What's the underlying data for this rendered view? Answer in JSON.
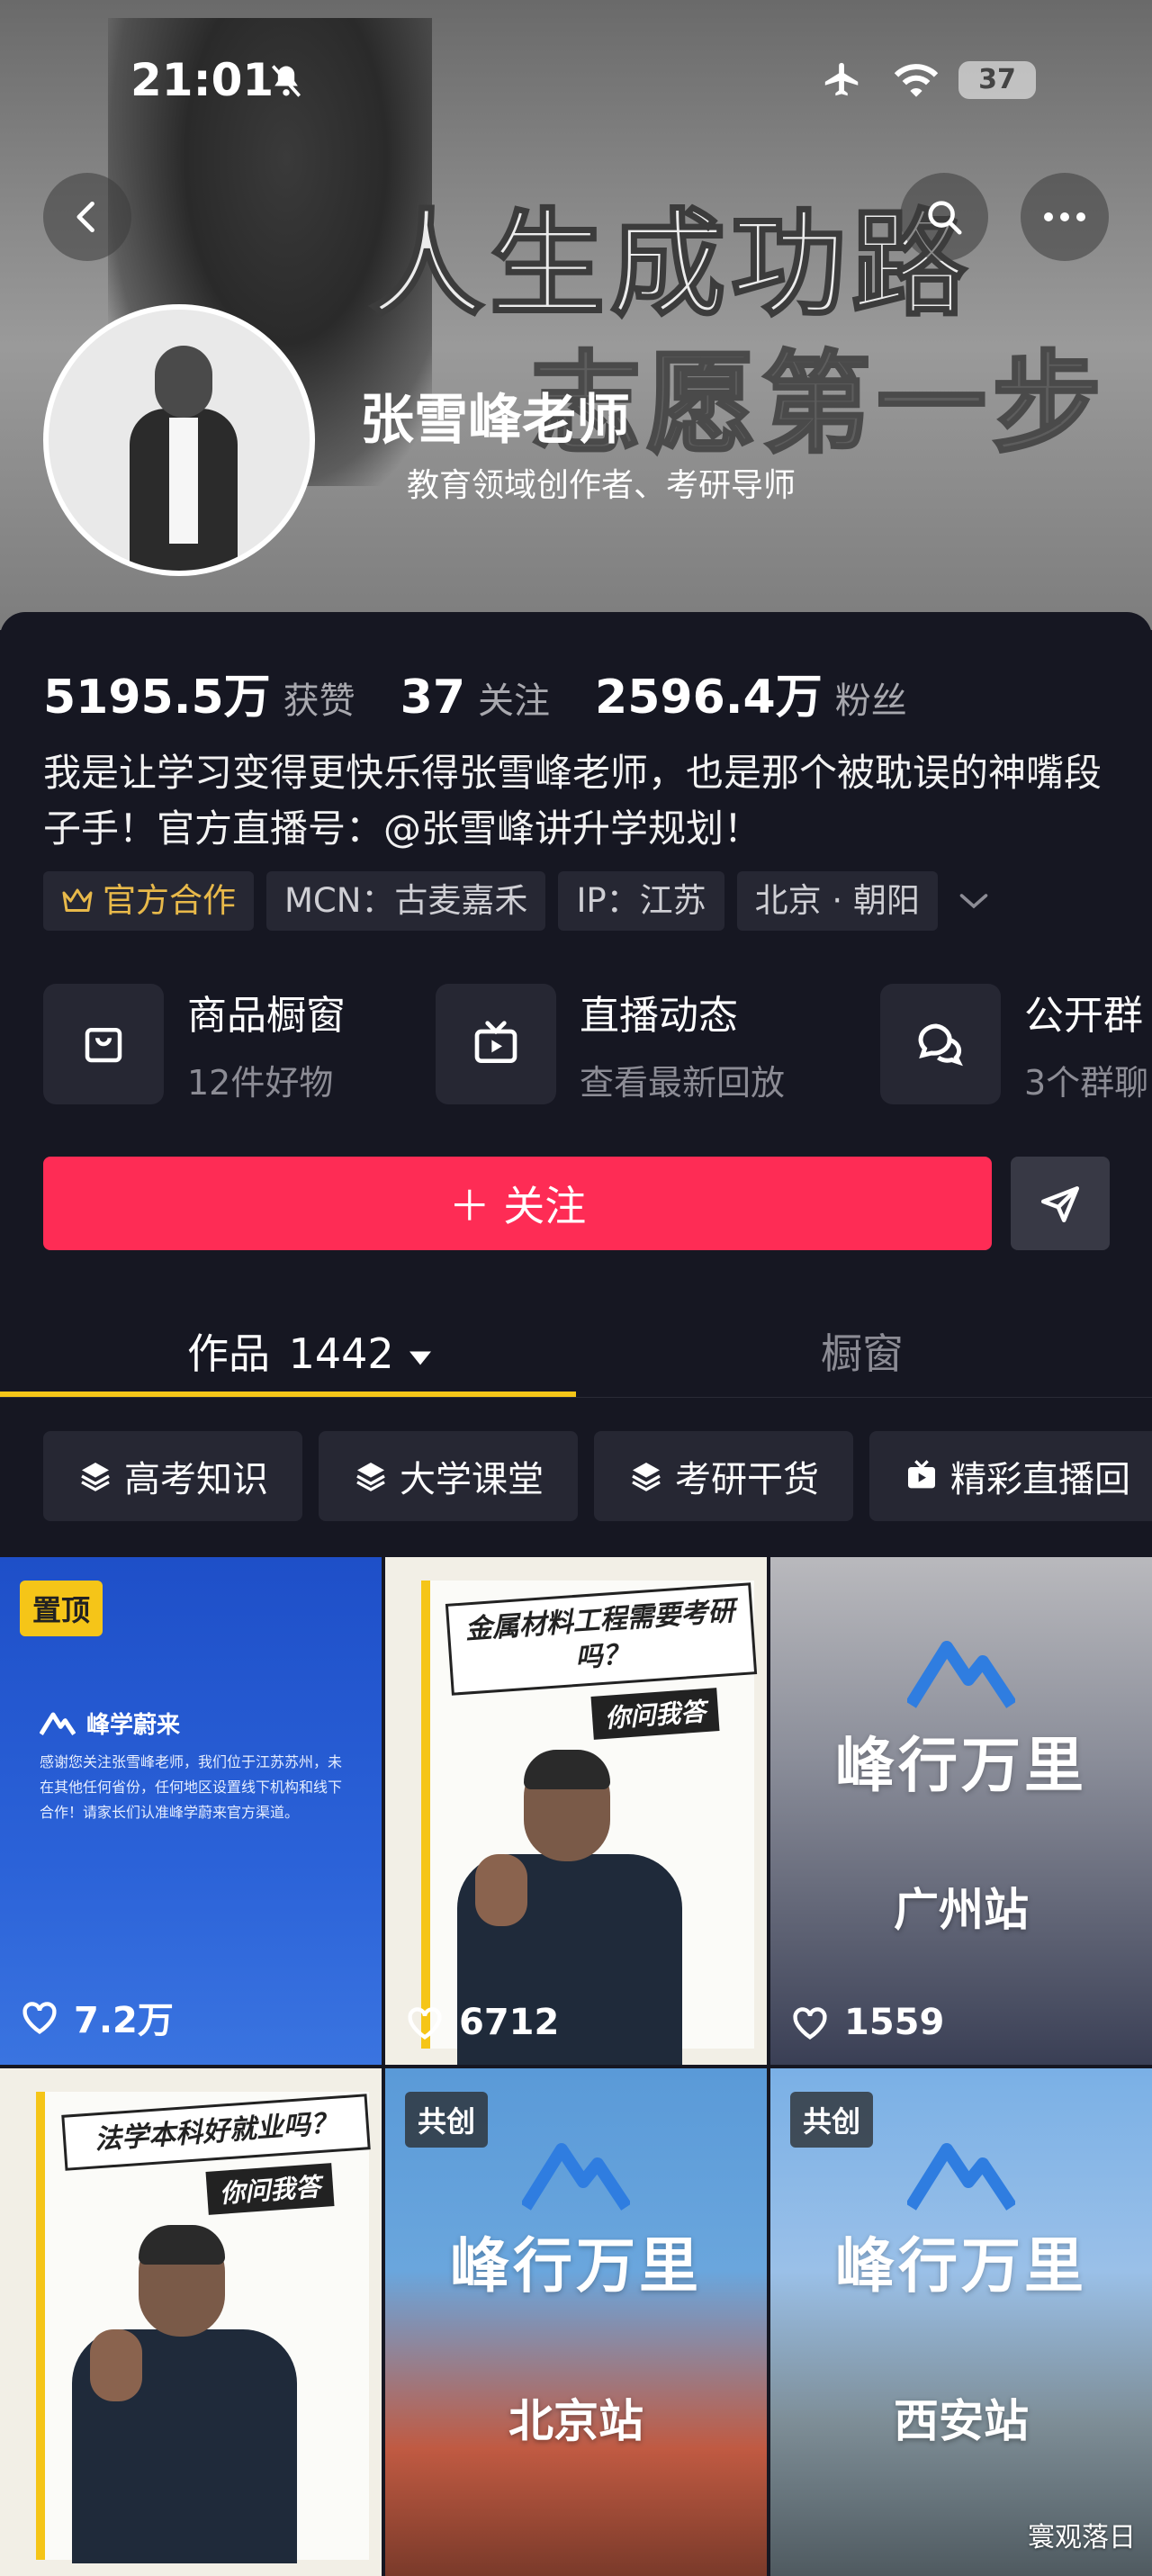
{
  "status_bar": {
    "time": "21:01",
    "battery": "37"
  },
  "banner": {
    "line1": "人生成功路",
    "line2": "志愿第一步"
  },
  "profile": {
    "name": "张雪峰老师",
    "subtitle": "教育领域创作者、考研导师"
  },
  "stats": {
    "likes_value": "5195.5万",
    "likes_label": "获赞",
    "following_value": "37",
    "following_label": "关注",
    "followers_value": "2596.4万",
    "followers_label": "粉丝"
  },
  "bio": "我是让学习变得更快乐得张雪峰老师，也是那个被耽误的神嘴段子手！官方直播号：@张雪峰讲升学规划！",
  "tags": {
    "official": "官方合作",
    "mcn": "MCN：古麦嘉禾",
    "ip": "IP：江苏",
    "location": "北京 · 朝阳"
  },
  "features": [
    {
      "title": "商品橱窗",
      "subtitle": "12件好物"
    },
    {
      "title": "直播动态",
      "subtitle": "查看最新回放"
    },
    {
      "title": "公开群",
      "subtitle": "3个群聊"
    }
  ],
  "actions": {
    "follow": "＋ 关注"
  },
  "tabs": {
    "works_label": "作品",
    "works_count": "1442",
    "shop_label": "橱窗"
  },
  "chips": [
    "高考知识",
    "大学课堂",
    "考研干货",
    "精彩直播回"
  ],
  "grid": {
    "tiles": [
      {
        "badge": "置顶",
        "likes": "7.2万",
        "brand": "峰学蔚来",
        "text": "感谢您关注张雪峰老师，我们位于江苏苏州，未在其他任何省份，任何地区设置线下机构和线下合作！请家长们认准峰学蔚来官方渠道。"
      },
      {
        "likes": "6712",
        "poster_title": "金属材料工程需要考研吗？",
        "poster_sub": "你问我答"
      },
      {
        "likes": "1559",
        "title": "峰行万里",
        "station": "广州站"
      },
      {
        "poster_title": "法学本科好就业吗？",
        "poster_sub": "你问我答"
      },
      {
        "badge": "共创",
        "title": "峰行万里",
        "station": "北京站"
      },
      {
        "badge": "共创",
        "title": "峰行万里",
        "station": "西安站"
      }
    ],
    "watermark": "寰观落日"
  },
  "colors": {
    "accent": "#fe2c55",
    "tab_indicator": "#f5c518",
    "background": "#161722",
    "gold": "#e8b94a"
  }
}
